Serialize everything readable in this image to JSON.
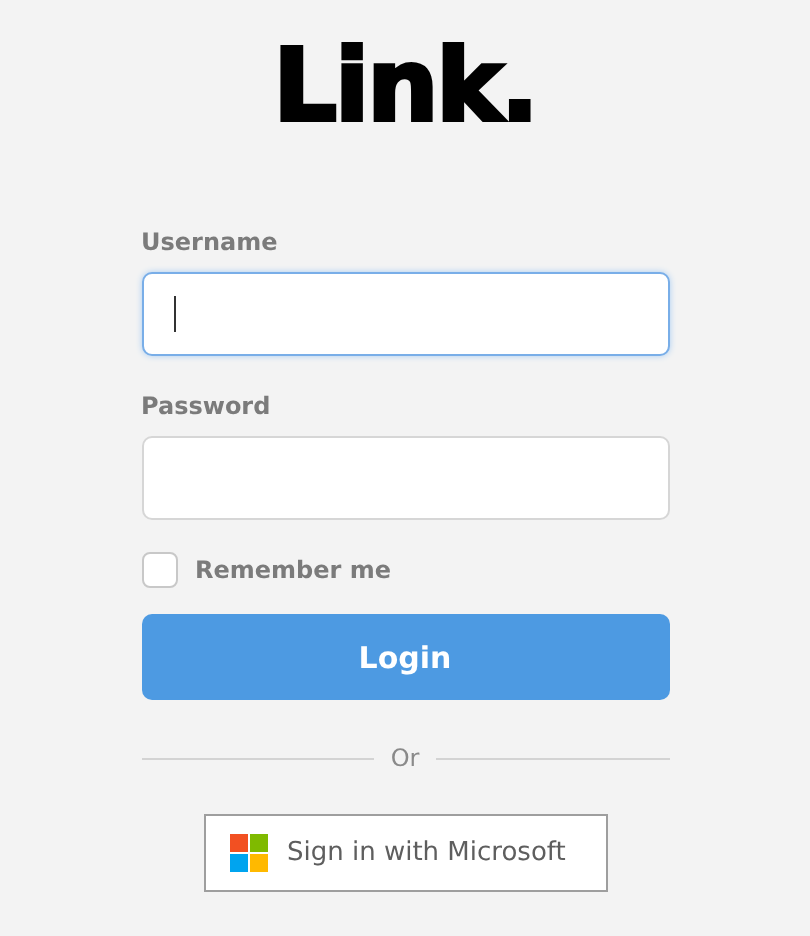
{
  "logo": {
    "text": "Link."
  },
  "fields": [
    {
      "label": "Username",
      "focused": true
    },
    {
      "label": "Password",
      "focused": false
    }
  ],
  "remember": {
    "label": "Remember me",
    "checked": false
  },
  "login_button": {
    "label": "Login"
  },
  "divider": {
    "text": "Or"
  },
  "microsoft_button": {
    "label": "Sign in with Microsoft"
  }
}
